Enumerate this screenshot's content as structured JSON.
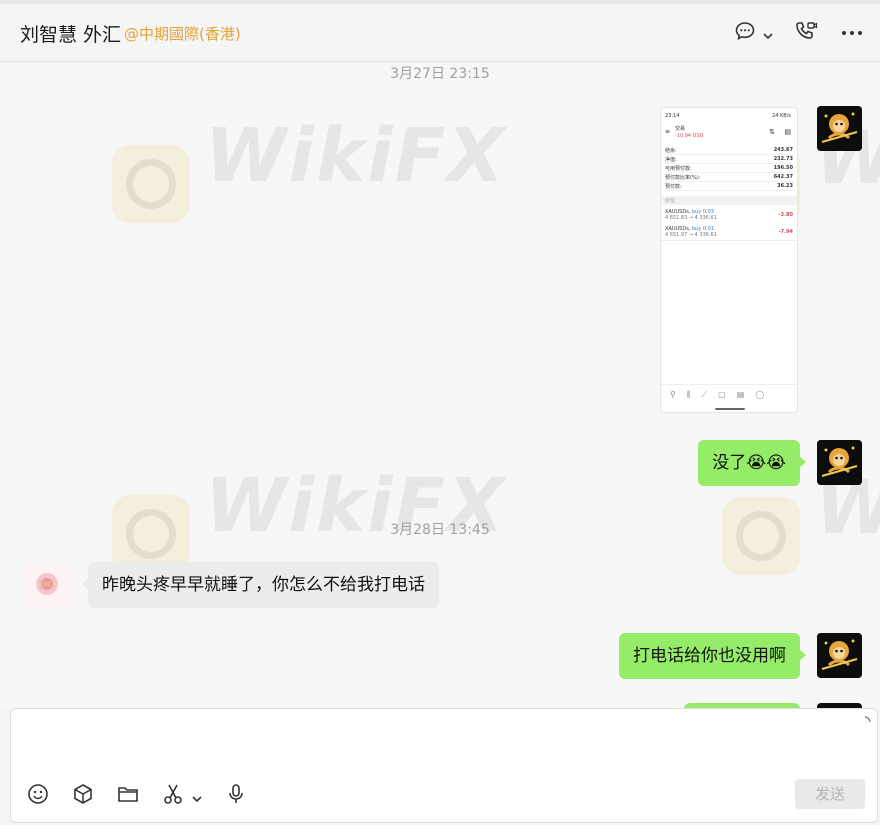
{
  "header": {
    "title": "刘智慧 外汇",
    "org": "@中期國際(香港)"
  },
  "watermark": "WikiFX",
  "timestamps": [
    "3月27日 23:15",
    "3月28日 13:45"
  ],
  "phone_screenshot": {
    "status_time": "23:14",
    "status_right": "24 KB/s",
    "title": "交易",
    "balance": "-10.94 USD",
    "rows": [
      {
        "label": "结余:",
        "value": "243.67"
      },
      {
        "label": "净值:",
        "value": "232.73"
      },
      {
        "label": "可用预付款:",
        "value": "196.50"
      },
      {
        "label": "预付款比率(%):",
        "value": "642.37"
      },
      {
        "label": "预付款:",
        "value": "36.23"
      }
    ],
    "section": "价位",
    "positions": [
      {
        "symbol": "XAUUSDs,",
        "side": "buy 0.03",
        "prices": "4 651.83 → 4 336.61",
        "pl": "-3.80"
      },
      {
        "symbol": "XAUUSDs,",
        "side": "buy 0.01",
        "prices": "4 651.97 → 4 336.61",
        "pl": "-7.94"
      }
    ]
  },
  "messages": [
    {
      "from": "me",
      "text": "没了",
      "emoji": "😭😭"
    },
    {
      "from": "them",
      "text": "昨晚头疼早早就睡了，你怎么不给我打电话"
    },
    {
      "from": "me",
      "text": "打电话给你也没用啊"
    }
  ],
  "composer": {
    "send_label": "发送"
  },
  "colors": {
    "accent_org": "#e3a33a",
    "bubble_me": "#95ec69",
    "bubble_them": "#ececec"
  }
}
